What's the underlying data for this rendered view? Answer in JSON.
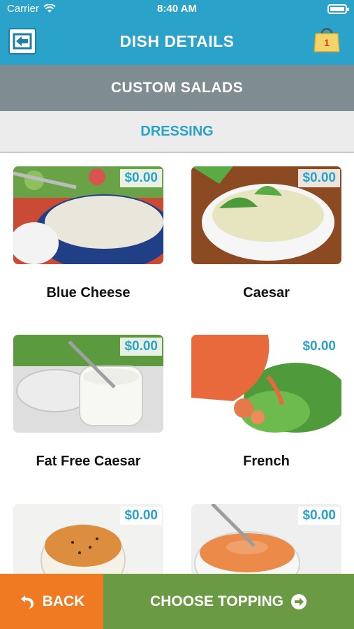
{
  "status_bar": {
    "carrier": "Carrier",
    "time": "8:40 AM"
  },
  "header": {
    "title": "DISH DETAILS",
    "cart_count": "1"
  },
  "category": {
    "title": "CUSTOM SALADS"
  },
  "section": {
    "tab_label": "DRESSING"
  },
  "items": [
    {
      "name": "Blue Cheese",
      "price": "$0.00"
    },
    {
      "name": "Caesar",
      "price": "$0.00"
    },
    {
      "name": "Fat Free Caesar",
      "price": "$0.00"
    },
    {
      "name": "French",
      "price": "$0.00"
    },
    {
      "name": "",
      "price": "$0.00"
    },
    {
      "name": "",
      "price": "$0.00"
    }
  ],
  "footer": {
    "back_label": "BACK",
    "choose_label": "CHOOSE TOPPING"
  },
  "colors": {
    "primary": "#2aa2c9",
    "category_bg": "#7f8c92",
    "back_bg": "#ef7a22",
    "choose_bg": "#6a9a43"
  }
}
